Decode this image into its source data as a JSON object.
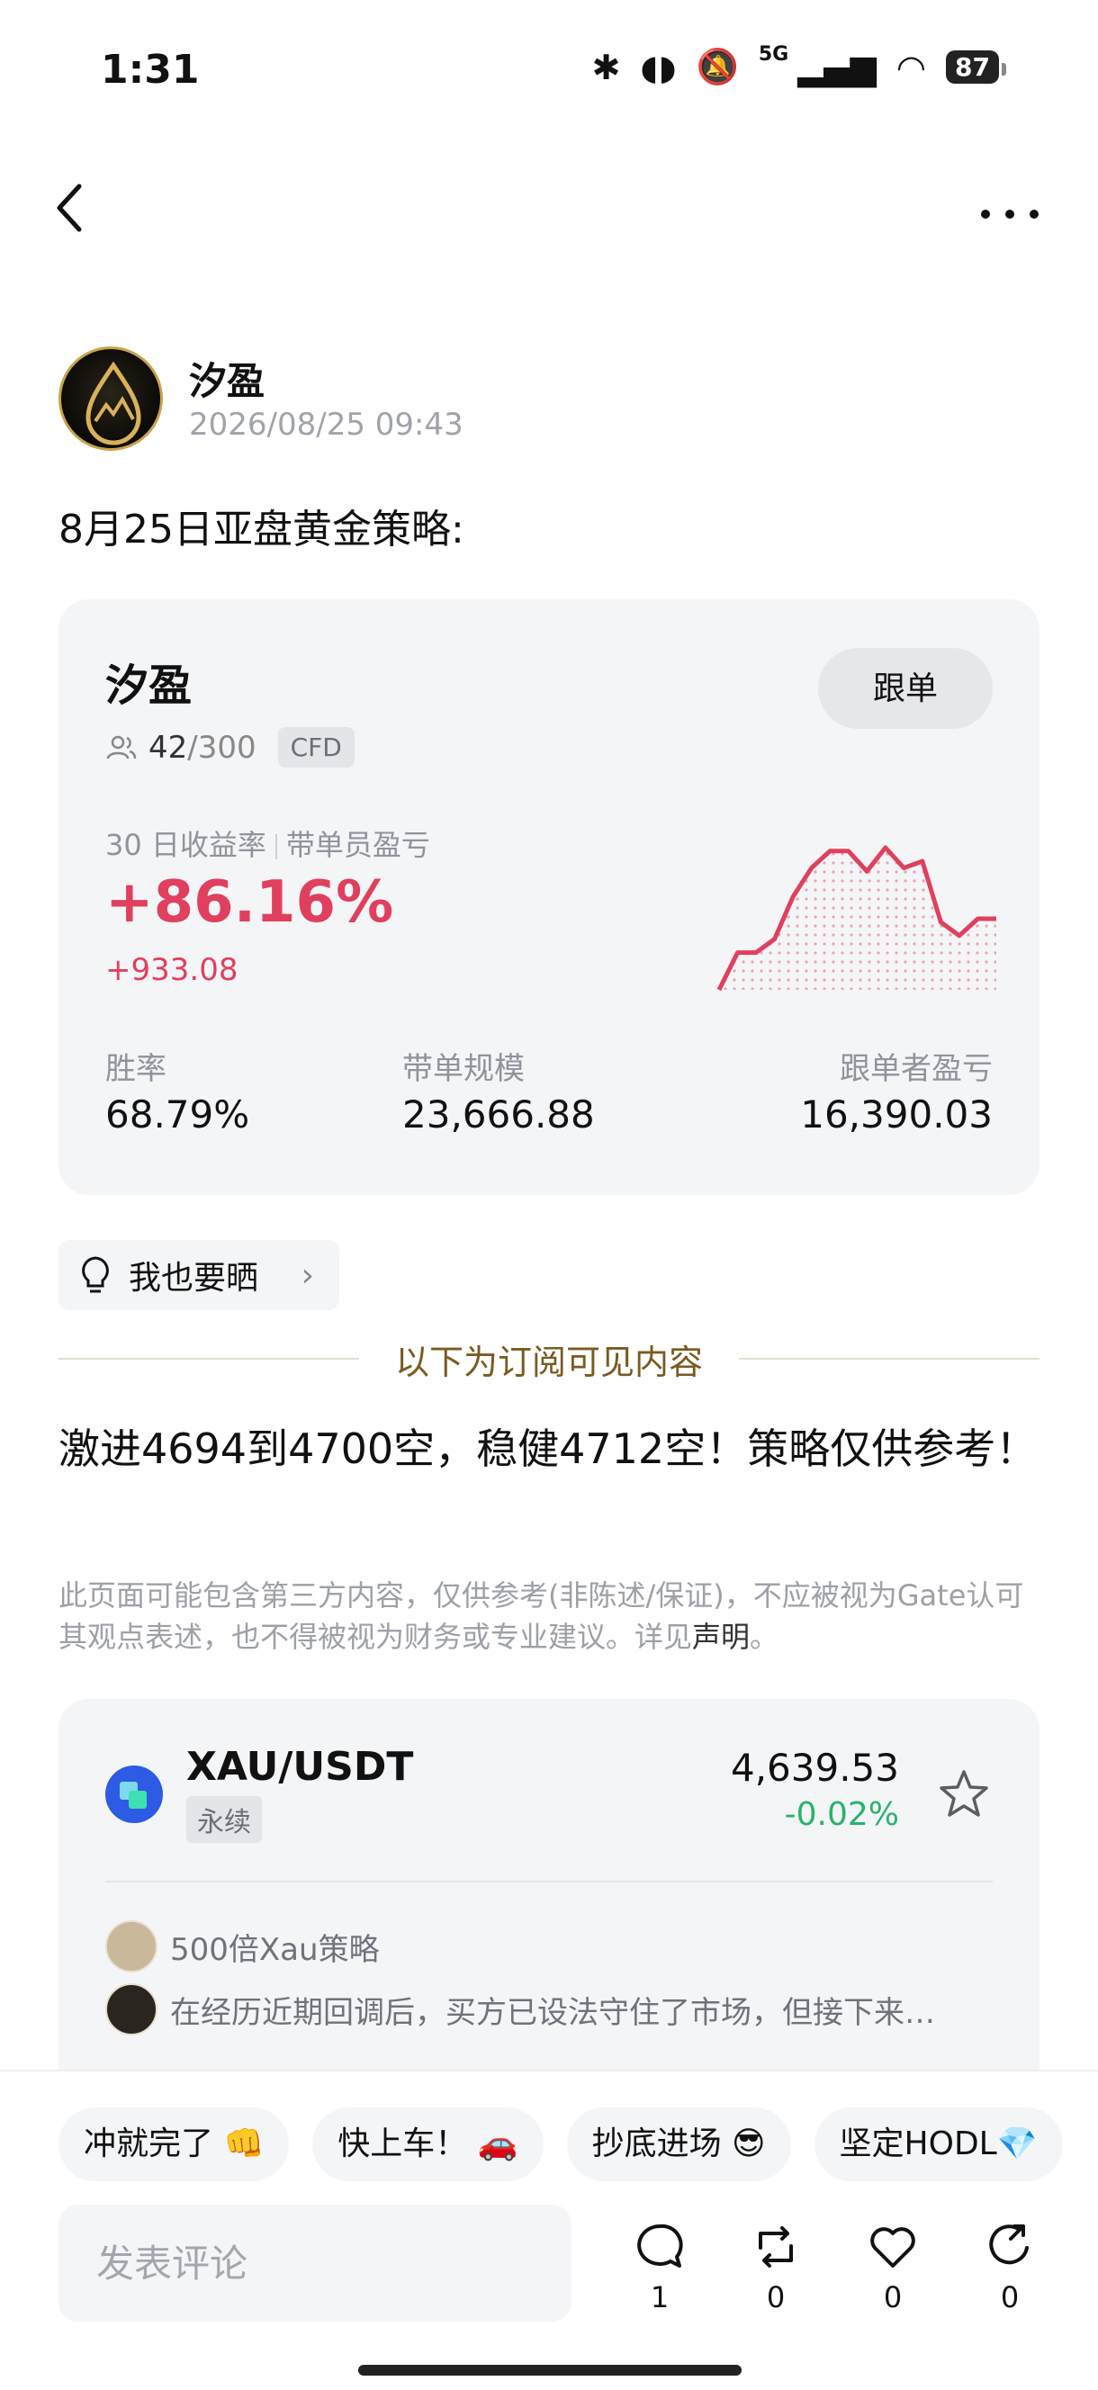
{
  "status_bar": {
    "time": "1:31",
    "network": "5G",
    "battery": "87"
  },
  "author": {
    "name": "汐盈",
    "time": "2026/08/25 09:43"
  },
  "post": {
    "title": "8月25日亚盘黄金策略:",
    "body": "激进4694到4700空，稳健4712空！策略仅供参考！",
    "disclaimer": "此页面可能包含第三方内容，仅供参考(非陈述/保证)，不应被视为Gate认可其观点表述，也不得被视为财务或专业建议。详见",
    "disclaimer_link": "声明",
    "disclaimer_end": "。"
  },
  "trader_card": {
    "name": "汐盈",
    "follow_label": "跟单",
    "followers": "42",
    "capacity": "/300",
    "tag": "CFD",
    "roi_label": "30 日收益率",
    "pnl_label": "带单员盈亏",
    "roi": "+86.16%",
    "pnl": "+933.08",
    "stats": [
      {
        "label": "胜率",
        "value": "68.79%"
      },
      {
        "label": "带单规模",
        "value": "23,666.88"
      },
      {
        "label": "跟单者盈亏",
        "value": "16,390.03"
      }
    ],
    "sparkline": [
      0,
      22,
      22,
      30,
      55,
      72,
      82,
      82,
      70,
      84,
      72,
      76,
      40,
      32,
      42,
      42
    ],
    "accent": "#e0405e"
  },
  "share_label": "我也要晒",
  "subscription_divider": "以下为订阅可见内容",
  "market": {
    "pair": "XAU/USDT",
    "type": "永续",
    "price": "4,639.53",
    "change": "-0.02%",
    "posts": [
      {
        "author": "500倍Xau策略"
      },
      {
        "text": "在经历近期回调后，买方已设法守住了市场，但接下来…"
      }
    ]
  },
  "bottom": {
    "chips": [
      "冲就完了 👊",
      "快上车！ 🚗",
      "抄底进场 😎",
      "坚定HODL💎"
    ],
    "comment_placeholder": "发表评论",
    "counts": {
      "comment": "1",
      "repost": "0",
      "like": "0",
      "share": "0"
    }
  }
}
